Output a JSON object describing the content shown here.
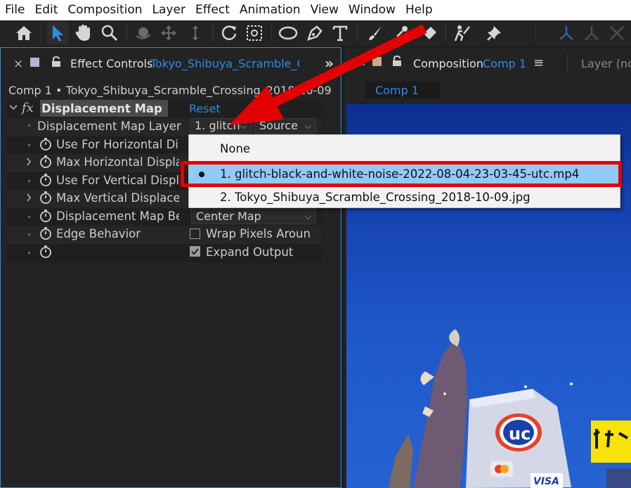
{
  "menu": [
    "File",
    "Edit",
    "Composition",
    "Layer",
    "Effect",
    "Animation",
    "View",
    "Window",
    "Help"
  ],
  "toolbar": {
    "tools": [
      "home-icon",
      "selection-arrow-icon",
      "hand-icon",
      "zoom-icon",
      "orbit-camera-icon",
      "pan-camera-icon",
      "dolly-camera-icon",
      "rotate-icon",
      "pan-behind-icon",
      "ellipse-icon",
      "pen-icon",
      "type-icon",
      "brush-icon",
      "clone-stamp-icon",
      "eraser-icon",
      "roto-brush-icon",
      "puppet-pin-icon",
      "axis-local-icon",
      "axis-world-icon",
      "axis-view-icon"
    ]
  },
  "effect_controls": {
    "close": "×",
    "tab_title": "Effect Controls",
    "tab_layer": "Tokyo_Shibuya_Scramble_C",
    "more": "»",
    "subtitle": "Comp 1 • Tokyo_Shibuya_Scramble_Crossing_2018-10-09",
    "fx_icon": "fx",
    "effect_name": "Displacement Map",
    "reset": "Reset",
    "properties": [
      {
        "label": "Displacement Map Layer"
      },
      {
        "label": "Use For Horizontal Di"
      },
      {
        "label": "Max Horizontal Displa"
      },
      {
        "label": "Use For Vertical Displ"
      },
      {
        "label": "Max Vertical Displace"
      },
      {
        "label": "Displacement Map Be"
      },
      {
        "label": "Edge Behavior"
      },
      {
        "label": ""
      }
    ],
    "layer_dropdown": "1. glitch",
    "source_dropdown": "Source",
    "behavior_dropdown": "Center Map",
    "wrap_pixels": "Wrap Pixels Aroun",
    "expand_output": "Expand Output",
    "wrap_checked": false,
    "expand_checked": true
  },
  "composition": {
    "tab_title": "Composition",
    "comp_name": "Comp 1",
    "menu_icon": "≡",
    "layer_tab": "Layer (nc",
    "comp_pill": "Comp 1"
  },
  "popup": {
    "options": [
      {
        "label": "None",
        "selected": false
      },
      {
        "label": "1. glitch-black-and-white-noise-2022-08-04-23-03-45-utc.mp4",
        "selected": true
      },
      {
        "label": "2. Tokyo_Shibuya_Scramble_Crossing_2018-10-09.jpg",
        "selected": false
      }
    ]
  },
  "colors": {
    "accent_blue": "#2d8ceb",
    "annotation_red": "#e30000",
    "selected_option": "#91c9f7"
  }
}
